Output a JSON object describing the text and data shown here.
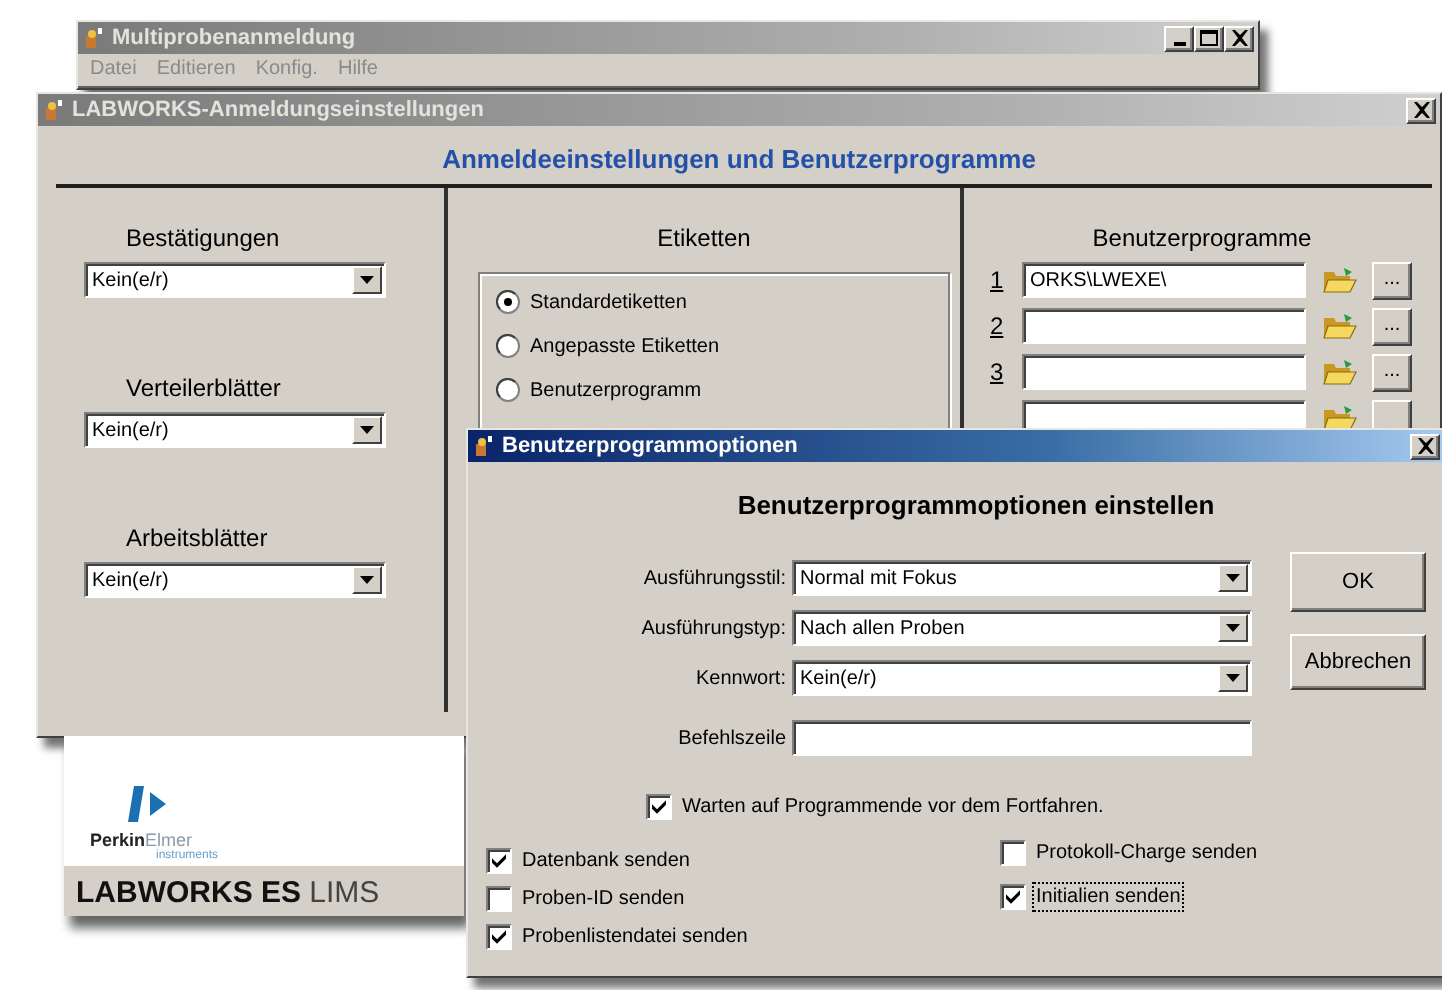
{
  "main_window": {
    "title": "Multiprobenanmeldung",
    "active": false,
    "resizable": true,
    "menu": [
      "Datei",
      "Editieren",
      "Konfig.",
      "Hilfe"
    ]
  },
  "settings_window": {
    "title": "LABWORKS-Anmeldungseinstellungen",
    "active": false,
    "resizable": false,
    "heading": "Anmeldeeinstellungen und Benutzerprogramme",
    "lists": [
      {
        "label": "Bestätigungen",
        "value": "Kein(e/r)"
      },
      {
        "label": "Verteilerblätter",
        "value": "Kein(e/r)"
      },
      {
        "label": "Arbeitsblätter",
        "value": "Kein(e/r)"
      }
    ],
    "labels": {
      "title": "Etiketten",
      "options": [
        {
          "label": "Standardetiketten",
          "selected": true
        },
        {
          "label": "Angepasste Etiketten",
          "selected": false
        },
        {
          "label": "Benutzerprogramm",
          "selected": false
        }
      ]
    },
    "user_programs": {
      "title": "Benutzerprogramme",
      "rows": [
        {
          "number": "1",
          "path": "ORKS\\LWEXE\\",
          "button": "..."
        },
        {
          "number": "2",
          "button": "..."
        },
        {
          "number": "3",
          "button": "..."
        },
        {}
      ]
    }
  },
  "splash": {
    "logo": "**Perkin**Elmer",
    "tagline": "instruments",
    "product": "**LABWORKS ES** LIMS"
  },
  "options_window": {
    "title": "Benutzerprogrammoptionen",
    "active": true,
    "resizable": false,
    "heading": "Benutzerprogrammoptionen einstellen",
    "fields": [
      {
        "label": "Ausführungsstil:",
        "value": "Normal mit Fokus",
        "kind": "dropdown"
      },
      {
        "label": "Ausführungstyp:",
        "value": "Nach allen Proben",
        "kind": "dropdown"
      },
      {
        "label": "Kennwort:",
        "value": "Kein(e/r)",
        "kind": "dropdown"
      },
      {
        "label": "Befehlszeile",
        "kind": "text"
      }
    ],
    "buttons": [
      "OK",
      "Abbrechen"
    ],
    "wait": {
      "label": "Warten auf Programmende vor dem Fortfahren.",
      "checked": true,
      "focused": false
    },
    "send_columns": [
      {
        "options": [
          {
            "label": "Datenbank senden",
            "checked": true,
            "focused": false
          },
          {
            "label": "Proben-ID senden",
            "checked": false,
            "focused": false
          },
          {
            "label": "Probenlistendatei senden",
            "checked": true,
            "focused": false
          }
        ]
      },
      {
        "options": [
          {
            "label": "Protokoll-Charge senden",
            "checked": false,
            "focused": false
          },
          {
            "label": "Initialien senden",
            "checked": true,
            "focused": true
          }
        ]
      }
    ]
  }
}
